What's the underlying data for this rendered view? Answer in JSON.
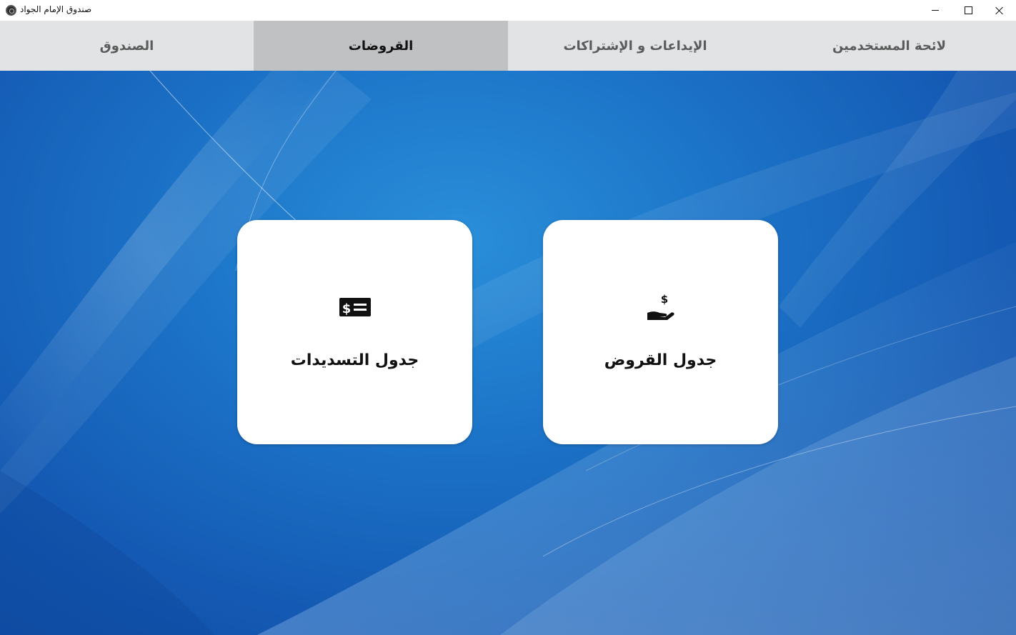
{
  "window": {
    "title": "صندوق الإمام الجواد",
    "icon": "app-logo-icon",
    "controls": [
      "minimize-icon",
      "maximize-icon",
      "close-icon"
    ]
  },
  "tabs": [
    {
      "label": "الصندوق",
      "active": false
    },
    {
      "label": "القروضات",
      "active": true
    },
    {
      "label": "الإيداعات و الإشتراكات",
      "active": false
    },
    {
      "label": "لائحة المستخدمين",
      "active": false
    }
  ],
  "cards": [
    {
      "label": "جدول التسديدات",
      "icon": "money-check-icon"
    },
    {
      "label": "جدول القروض",
      "icon": "hand-holding-dollar-icon"
    }
  ],
  "colors": {
    "tabbar_bg": "#e2e3e5",
    "tab_active_bg": "#c0c1c3",
    "wallpaper_blue": "#1c74c8",
    "card_bg": "#ffffff"
  }
}
